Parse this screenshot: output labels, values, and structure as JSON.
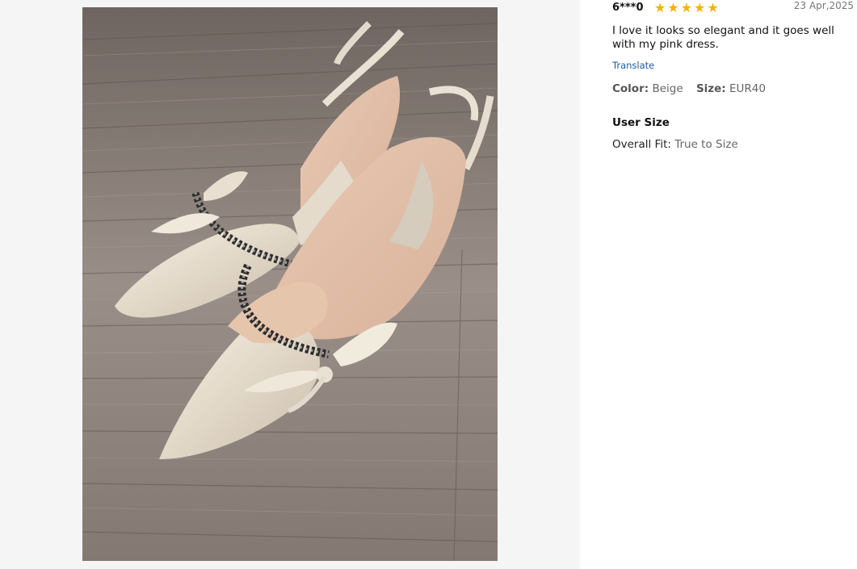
{
  "review": {
    "user": "6***0",
    "rating": 5,
    "stars": "★★★★★",
    "date": "23 Apr,2025",
    "content": "I love it looks so elegant and it goes well with my pink dress.",
    "translate_label": "Translate",
    "color_label": "Color:",
    "color_value": "Beige",
    "size_label": "Size:",
    "size_value": "EUR40",
    "user_size_title": "User Size",
    "fit_label": "Overall Fit:",
    "fit_value": "True to Size"
  },
  "colors": {
    "star": "#f5b301",
    "link": "#1a5a9c",
    "gallery_bg": "#f5f5f5"
  }
}
